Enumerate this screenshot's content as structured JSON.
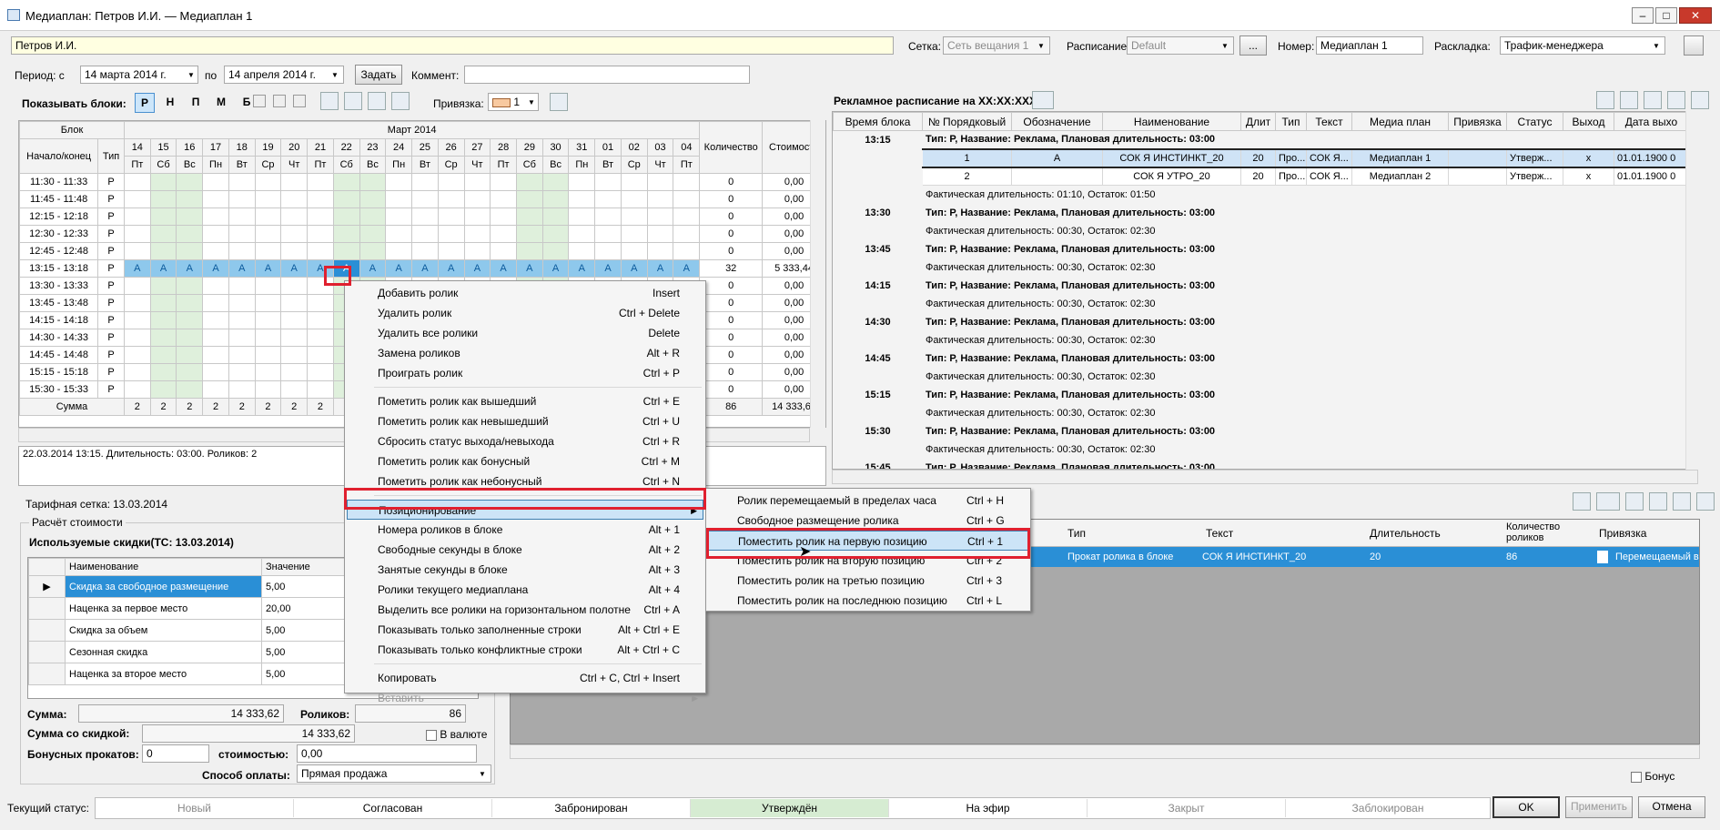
{
  "window": {
    "title": "Медиаплан: Петров И.И. — Медиаплан 1"
  },
  "top": {
    "client": "Петров И.И.",
    "grid_label": "Сетка:",
    "grid_value": "Сеть вещания 1",
    "schedule_label": "Расписание:",
    "schedule_value": "Default",
    "number_label": "Номер:",
    "number_value": "Медиаплан 1",
    "layout_label": "Раскладка:",
    "layout_value": "Трафик-менеджера",
    "dots": "...",
    "period_label": "Период: с",
    "period_from": "14   марта   2014 г.",
    "to_label": "по",
    "period_to": "14  апреля   2014 г.",
    "set_button": "Задать",
    "comment_label": "Коммент:",
    "comment_value": ""
  },
  "blocks_bar": {
    "label": "Показывать блоки:",
    "items": [
      "Р",
      "Н",
      "П",
      "М",
      "Б"
    ],
    "binding_label": "Привязка:",
    "binding_value": "1"
  },
  "grid": {
    "block_header": "Блок",
    "month_header": "Март 2014",
    "start_end_header": "Начало/конец",
    "type_header": "Тип",
    "qty_header": "Количество",
    "cost_header": "Стоимость",
    "days": [
      "14",
      "15",
      "16",
      "17",
      "18",
      "19",
      "20",
      "21",
      "22",
      "23",
      "24",
      "25",
      "26",
      "27",
      "28",
      "29",
      "30",
      "31",
      "01",
      "02",
      "03",
      "04"
    ],
    "weekdays": [
      "Пт",
      "Сб",
      "Вс",
      "Пн",
      "Вт",
      "Ср",
      "Чт",
      "Пт",
      "Сб",
      "Вс",
      "Пн",
      "Вт",
      "Ср",
      "Чт",
      "Пт",
      "Сб",
      "Вс",
      "Пн",
      "Вт",
      "Ср",
      "Чт",
      "Пт"
    ],
    "rows": [
      {
        "time": "11:30 - 11:33",
        "type": "Р",
        "qty": "0",
        "cost": "0,00"
      },
      {
        "time": "11:45 - 11:48",
        "type": "Р",
        "qty": "0",
        "cost": "0,00"
      },
      {
        "time": "12:15 - 12:18",
        "type": "Р",
        "qty": "0",
        "cost": "0,00"
      },
      {
        "time": "12:30 - 12:33",
        "type": "Р",
        "qty": "0",
        "cost": "0,00"
      },
      {
        "time": "12:45 - 12:48",
        "type": "Р",
        "qty": "0",
        "cost": "0,00"
      },
      {
        "time": "13:15 - 13:18",
        "type": "Р",
        "qty": "32",
        "cost": "5 333,44",
        "mark": "А"
      },
      {
        "time": "13:30 - 13:33",
        "type": "Р",
        "qty": "0",
        "cost": "0,00"
      },
      {
        "time": "13:45 - 13:48",
        "type": "Р",
        "qty": "0",
        "cost": "0,00"
      },
      {
        "time": "14:15 - 14:18",
        "type": "Р",
        "qty": "0",
        "cost": "0,00"
      },
      {
        "time": "14:30 - 14:33",
        "type": "Р",
        "qty": "0",
        "cost": "0,00"
      },
      {
        "time": "14:45 - 14:48",
        "type": "Р",
        "qty": "0",
        "cost": "0,00"
      },
      {
        "time": "15:15 - 15:18",
        "type": "Р",
        "qty": "0",
        "cost": "0,00"
      },
      {
        "time": "15:30 - 15:33",
        "type": "Р",
        "qty": "0",
        "cost": "0,00"
      }
    ],
    "sum_label": "Сумма",
    "sum_days": [
      "2",
      "2",
      "2",
      "2",
      "2",
      "2",
      "2",
      "2",
      "2"
    ],
    "sum_qty": "86",
    "sum_cost": "14 333,62"
  },
  "info_text": "22.03.2014 13:15. Длительность: 03:00. Роликов: 2",
  "tariff": {
    "label": "Тарифная сетка:",
    "date": "13.03.2014"
  },
  "calc": {
    "group": "Расчёт стоимости",
    "discounts_title": "Используемые скидки(ТС: 13.03.2014)",
    "col_name": "Наименование",
    "col_value": "Значение",
    "rows": [
      {
        "name": "Скидка за свободное размещение",
        "value": "5,00"
      },
      {
        "name": "Наценка за первое место",
        "value": "20,00"
      },
      {
        "name": "Скидка за объем",
        "value": "5,00"
      },
      {
        "name": "Сезонная скидка",
        "value": "5,00"
      },
      {
        "name": "Наценка за второе место",
        "value": "5,00"
      }
    ],
    "sum_label": "Сумма:",
    "sum_value": "14 333,62",
    "spots_label": "Роликов:",
    "spots_value": "86",
    "disc_sum_label": "Сумма со скидкой:",
    "disc_sum_value": "14 333,62",
    "currency_label": "В валюте",
    "bonus_label": "Бонусных прокатов:",
    "bonus_value": "0",
    "cost_label": "стоимостью:",
    "cost_value": "0,00",
    "pay_label": "Способ оплаты:",
    "pay_value": "Прямая продажа"
  },
  "ad_schedule": {
    "title": "Рекламное расписание на XX:XX:XXXX",
    "cols": [
      "Время блока",
      "№ Порядковый",
      "Обозначение",
      "Наименование",
      "Длит",
      "Тип",
      "Текст",
      "Медиа план",
      "Привязка",
      "Статус",
      "Выход",
      "Дата выхо"
    ],
    "block_1315": {
      "time": "13:15",
      "desc": "Тип: Р, Название: Реклама, Плановая длительность: 03:00"
    },
    "spots": [
      {
        "n": "1",
        "mark": "А",
        "name": "СОК Я ИНСТИНКТ_20",
        "dur": "20",
        "type": "Про...",
        "text": "СОК Я...",
        "plan": "Медиаплан 1",
        "status": "Утверж...",
        "out": "x",
        "date": "01.01.1900  0"
      },
      {
        "n": "2",
        "mark": "",
        "name": "СОК Я УТРО_20",
        "dur": "20",
        "type": "Про...",
        "text": "СОК Я...",
        "plan": "Медиаплан 2",
        "status": "Утверж...",
        "out": "x",
        "date": "01.01.1900  0"
      }
    ],
    "fact_1315": "Фактическая длительность: 01:10, Остаток: 01:50",
    "blocks": [
      {
        "time": "13:30",
        "desc": "Тип: Р, Название: Реклама, Плановая длительность: 03:00",
        "fact": "Фактическая длительность: 00:30, Остаток: 02:30"
      },
      {
        "time": "13:45",
        "desc": "Тип: Р, Название: Реклама, Плановая длительность: 03:00",
        "fact": "Фактическая длительность: 00:30, Остаток: 02:30"
      },
      {
        "time": "14:15",
        "desc": "Тип: Р, Название: Реклама, Плановая длительность: 03:00",
        "fact": "Фактическая длительность: 00:30, Остаток: 02:30"
      },
      {
        "time": "14:30",
        "desc": "Тип: Р, Название: Реклама, Плановая длительность: 03:00",
        "fact": "Фактическая длительность: 00:30, Остаток: 02:30"
      },
      {
        "time": "14:45",
        "desc": "Тип: Р, Название: Реклама, Плановая длительность: 03:00",
        "fact": "Фактическая длительность: 00:30, Остаток: 02:30"
      },
      {
        "time": "15:15",
        "desc": "Тип: Р, Название: Реклама, Плановая длительность: 03:00",
        "fact": "Фактическая длительность: 00:30, Остаток: 02:30"
      },
      {
        "time": "15:30",
        "desc": "Тип: Р, Название: Реклама, Плановая длительность: 03:00",
        "fact": "Фактическая длительность: 00:30, Остаток: 02:30"
      },
      {
        "time": "15:45",
        "desc": "Тип: Р, Название: Реклама, Плановая длительность: 03:00",
        "fact": ""
      }
    ]
  },
  "bottom_table": {
    "cols": [
      "Тип",
      "Текст",
      "Длительность",
      "Количество роликов",
      "Привязка"
    ],
    "row": {
      "type": "Прокат ролика в блоке",
      "text": "СОК Я ИНСТИНКТ_20",
      "dur": "20",
      "qty": "86",
      "bind": "Перемещаемый  в"
    }
  },
  "context_menu": {
    "items": [
      {
        "label": "Добавить ролик",
        "sc": "Insert"
      },
      {
        "label": "Удалить ролик",
        "sc": "Ctrl + Delete"
      },
      {
        "label": "Удалить все ролики",
        "sc": "Delete"
      },
      {
        "label": "Замена роликов",
        "sc": "Alt + R"
      },
      {
        "label": "Проиграть ролик",
        "sc": "Ctrl + P"
      },
      {
        "sep": true
      },
      {
        "label": "Пометить ролик как вышедший",
        "sc": "Ctrl + E"
      },
      {
        "label": "Пометить ролик как невышедший",
        "sc": "Ctrl + U"
      },
      {
        "label": "Сбросить статус выхода/невыхода",
        "sc": "Ctrl + R"
      },
      {
        "label": "Пометить ролик как бонусный",
        "sc": "Ctrl + M"
      },
      {
        "label": "Пометить ролик как небонусный",
        "sc": "Ctrl + N"
      },
      {
        "sep": true
      },
      {
        "label": "Позиционирование",
        "sc": "",
        "sub": true,
        "sel": true
      },
      {
        "label": "Номера роликов в блоке",
        "sc": "Alt + 1"
      },
      {
        "label": "Свободные секунды в блоке",
        "sc": "Alt + 2"
      },
      {
        "label": "Занятые секунды в блоке",
        "sc": "Alt + 3"
      },
      {
        "label": "Ролики текущего медиаплана",
        "sc": "Alt + 4"
      },
      {
        "label": "Выделить все ролики на горизонтальном полотне",
        "sc": "Ctrl + A"
      },
      {
        "label": "Показывать только заполненные строки",
        "sc": "Alt + Ctrl + E"
      },
      {
        "label": "Показывать только конфликтные строки",
        "sc": "Alt + Ctrl + C"
      },
      {
        "sep": true
      },
      {
        "label": "Копировать",
        "sc": "Ctrl + C, Ctrl + Insert"
      },
      {
        "label": "Вставить",
        "sc": "",
        "sub": true,
        "disabled": true
      }
    ]
  },
  "submenu": {
    "items": [
      {
        "label": "Ролик перемещаемый в пределах часа",
        "sc": "Ctrl + H"
      },
      {
        "label": "Свободное размещение ролика",
        "sc": "Ctrl + G"
      },
      {
        "label": "Поместить ролик на первую позицию",
        "sc": "Ctrl + 1",
        "sel": true
      },
      {
        "label": "Поместить ролик на вторую позицию",
        "sc": "Ctrl + 2"
      },
      {
        "label": "Поместить ролик на третью позицию",
        "sc": "Ctrl + 3"
      },
      {
        "label": "Поместить ролик на последнюю позицию",
        "sc": "Ctrl + L"
      }
    ]
  },
  "bonus_label": "Бонус",
  "status": {
    "label": "Текущий статус:",
    "segments": [
      "Новый",
      "Согласован",
      "Забронирован",
      "Утверждён",
      "На эфир",
      "Закрыт",
      "Заблокирован"
    ],
    "active": "Утверждён"
  },
  "buttons": {
    "ok": "OK",
    "apply": "Применить",
    "cancel": "Отмена"
  },
  "colors": {
    "highlight_red": "#e0202f",
    "row_select": "#2a8fd6",
    "weekend_green": "#dff0dc",
    "status_green": "#d6ecd2"
  }
}
